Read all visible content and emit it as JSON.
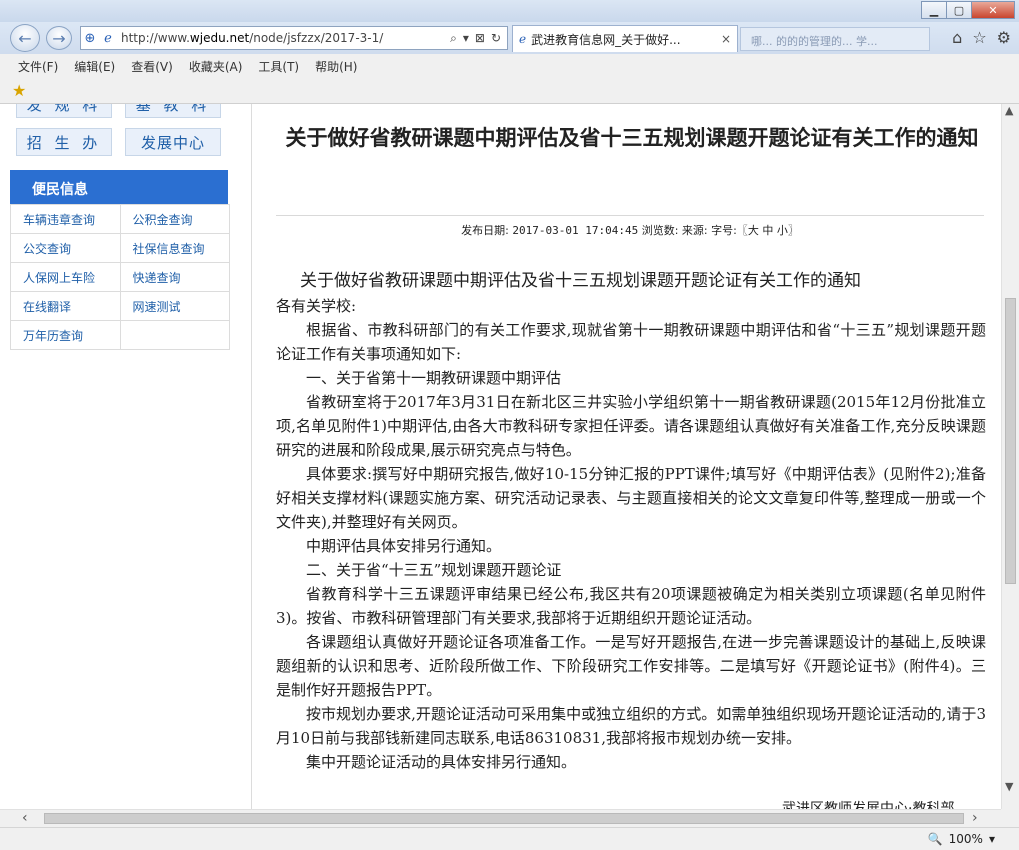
{
  "browser": {
    "url_prefix": "http://www.",
    "url_domain": "wjedu.net",
    "url_path": "/node/jsfzzx/2017-3-1/",
    "tab_title": "武进教育信息网_关于做好...",
    "tab_close": "×",
    "inactive_tab": "哪... 的的的管理的... 学...",
    "menu": [
      "文件(F)",
      "编辑(E)",
      "查看(V)",
      "收藏夹(A)",
      "工具(T)",
      "帮助(H)"
    ],
    "zoom": "100%"
  },
  "sidebar": {
    "top_buttons": [
      "发 规 科",
      "基 教 科"
    ],
    "buttons": [
      "招 生 办",
      "发展中心"
    ],
    "convenience_header": "便民信息",
    "links": [
      [
        "车辆违章查询",
        "公积金查询"
      ],
      [
        "公交查询",
        "社保信息查询"
      ],
      [
        "人保网上车险",
        "快递查询"
      ],
      [
        "在线翻译",
        "网速测试"
      ],
      [
        "万年历查询",
        ""
      ]
    ]
  },
  "article": {
    "title": "关于做好省教研课题中期评估及省十三五规划课题开题论证有关工作的通知",
    "meta_label_date": "发布日期:",
    "meta_date": "2017-03-01 17:04:45",
    "meta_views": "浏览数:",
    "meta_source": "来源:",
    "meta_fontsize": "字号:〖大 中 小〗",
    "body_heading": "关于做好省教研课题中期评估及省十三五规划课题开题论证有关工作的通知",
    "greeting": "各有关学校:",
    "paragraphs": [
      "根据省、市教科研部门的有关工作要求,现就省第十一期教研课题中期评估和省“十三五”规划课题开题论证工作有关事项通知如下:",
      "一、关于省第十一期教研课题中期评估",
      "省教研室将于2017年3月31日在新北区三井实验小学组织第十一期省教研课题(2015年12月份批准立项,名单见附件1)中期评估,由各大市教科研专家担任评委。请各课题组认真做好有关准备工作,充分反映课题研究的进展和阶段成果,展示研究亮点与特色。",
      "具体要求:撰写好中期研究报告,做好10-15分钟汇报的PPT课件;填写好《中期评估表》(见附件2);准备好相关支撑材料(课题实施方案、研究活动记录表、与主题直接相关的论文文章复印件等,整理成一册或一个文件夹),并整理好有关网页。",
      "中期评估具体安排另行通知。",
      "二、关于省“十三五”规划课题开题论证",
      "省教育科学十三五课题评审结果已经公布,我区共有20项课题被确定为相关类别立项课题(名单见附件3)。按省、市教科研管理部门有关要求,我部将于近期组织开题论证活动。",
      "各课题组认真做好开题论证各项准备工作。一是写好开题报告,在进一步完善课题设计的基础上,反映课题组新的认识和思考、近阶段所做工作、下阶段研究工作安排等。二是填写好《开题论证书》(附件4)。三是制作好开题报告PPT。",
      "按市规划办要求,开题论证活动可采用集中或独立组织的方式。如需单独组织现场开题论证活动的,请于3月10日前与我部钱新建同志联系,电话86310831,我部将报市规划办统一安排。",
      "集中开题论证活动的具体安排另行通知。"
    ],
    "signature": "武进区教师发展中心·教科部"
  }
}
